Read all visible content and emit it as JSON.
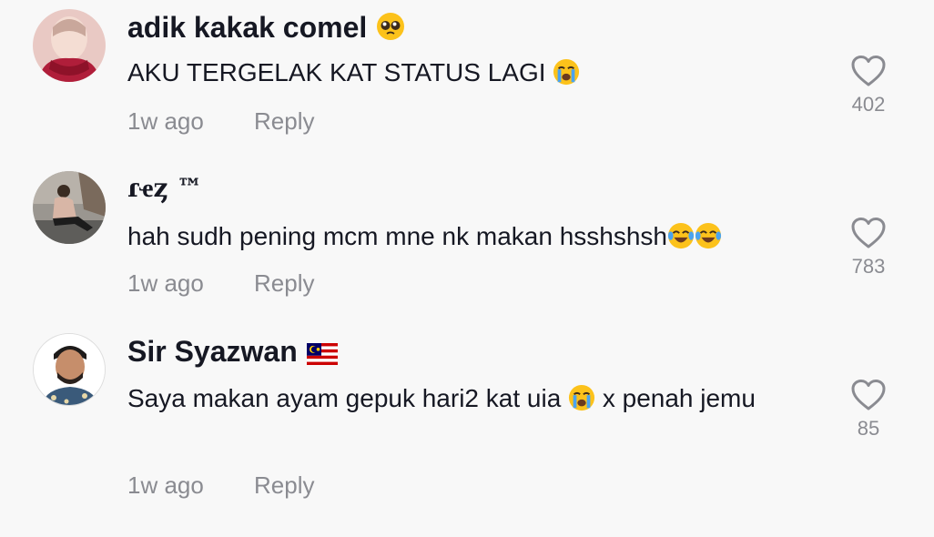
{
  "comments": [
    {
      "username": "adik kakak comel",
      "username_emoji": "pleading-face-icon",
      "text": "AKU TERGELAK KAT STATUS LAGI",
      "text_emoji": "loudly-crying-face-icon",
      "time": "1w ago",
      "reply_label": "Reply",
      "likes": "402"
    },
    {
      "username": "ɾҽȥ ™",
      "text": "hah sudh pening mcm mne nk makan hsshshsh",
      "text_emoji": "face-with-tears-of-joy-icon",
      "time": "1w ago",
      "reply_label": "Reply",
      "likes": "783"
    },
    {
      "username": "Sir Syazwan",
      "username_emoji": "malaysia-flag-icon",
      "text_part1": "Saya makan ayam gepuk hari2 kat uia",
      "text_emoji": "loudly-crying-face-icon",
      "text_part2": "x penah jemu",
      "time": "1w ago",
      "reply_label": "Reply",
      "likes": "85"
    }
  ],
  "colors": {
    "background": "#f8f8f8",
    "text_primary": "#161823",
    "text_secondary": "#8a8b91"
  }
}
